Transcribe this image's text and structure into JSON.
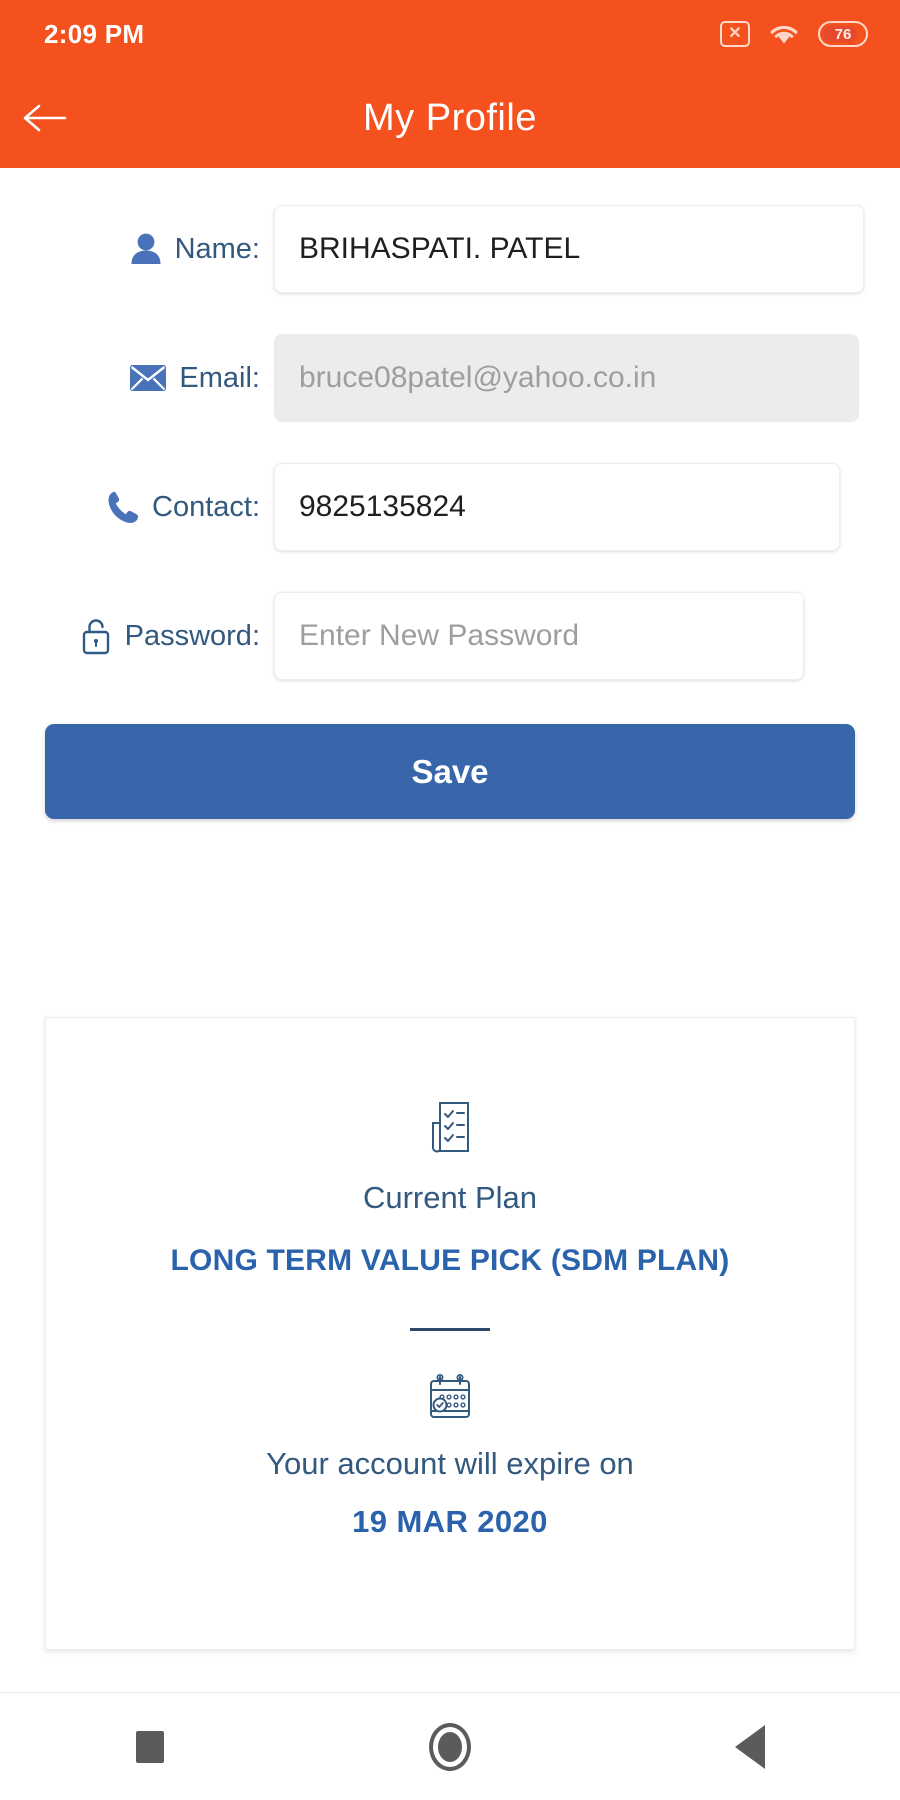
{
  "status_bar": {
    "time": "2:09 PM",
    "sim_icon": "sim-x-icon",
    "sim_glyph": "✕",
    "wifi_icon": "wifi-icon",
    "battery_icon": "battery-icon",
    "battery_level": "76"
  },
  "app_bar": {
    "back_icon": "back-arrow-icon",
    "title": "My Profile",
    "background_color": "#f4511e"
  },
  "form": {
    "rows": [
      {
        "icon": "person-icon",
        "label": "Name:",
        "value": "BRIHASPATI. PATEL",
        "placeholder": "",
        "disabled": false
      },
      {
        "icon": "envelope-icon",
        "label": "Email:",
        "value": "bruce08patel@yahoo.co.in",
        "placeholder": "",
        "disabled": true
      },
      {
        "icon": "phone-icon",
        "label": "Contact:",
        "value": "9825135824",
        "placeholder": "",
        "disabled": false
      },
      {
        "icon": "lock-open-icon",
        "label": "Password:",
        "value": "",
        "placeholder": "Enter New Password",
        "disabled": false
      }
    ],
    "save_label": "Save",
    "save_color": "#3966ab",
    "label_color": "#33597f"
  },
  "plan_card": {
    "plan_icon": "checklist-document-icon",
    "caption": "Current Plan",
    "plan_name": "LONG TERM VALUE PICK (SDM PLAN)",
    "expiry_icon": "calendar-check-icon",
    "expiry_text": "Your account will expire on",
    "expiry_date": "19 MAR 2020",
    "accent_color": "#2a62ab"
  },
  "nav_bar": {
    "recents_icon": "square-recents-icon",
    "home_icon": "circle-home-icon",
    "back_icon": "triangle-back-icon"
  }
}
